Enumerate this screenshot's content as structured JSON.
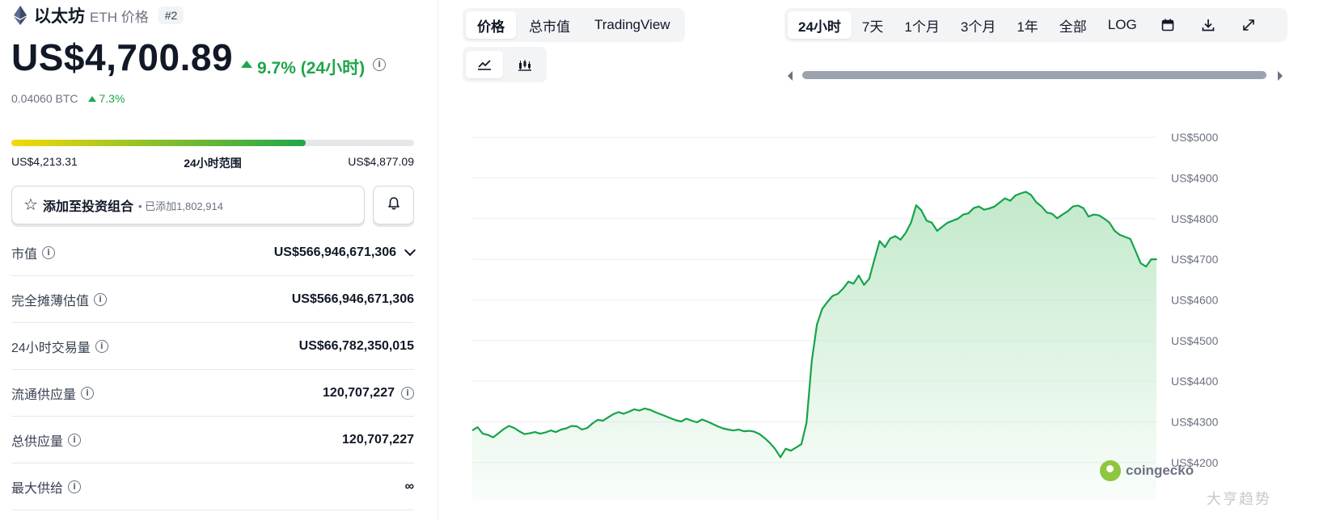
{
  "coin": {
    "name": "以太坊",
    "symbol_label": "ETH 价格",
    "rank": "#2",
    "icon": "ethereum-icon"
  },
  "price": {
    "value": "US$4,700.89",
    "change": "9.7% (24小时)",
    "btc_value": "0.04060 BTC",
    "btc_change": "7.3%"
  },
  "range": {
    "low": "US$4,213.31",
    "label": "24小时范围",
    "high": "US$4,877.09",
    "fill_fraction": 0.73
  },
  "portfolio": {
    "label": "添加至投资组合",
    "added": "已添加1,802,914"
  },
  "stats": [
    {
      "label": "市值",
      "value": "US$566,946,671,306",
      "info": true,
      "chevron": true,
      "value_info": false
    },
    {
      "label": "完全摊薄估值",
      "value": "US$566,946,671,306",
      "info": true,
      "chevron": false,
      "value_info": false
    },
    {
      "label": "24小时交易量",
      "value": "US$66,782,350,015",
      "info": true,
      "chevron": false,
      "value_info": false
    },
    {
      "label": "流通供应量",
      "value": "120,707,227",
      "info": true,
      "chevron": false,
      "value_info": true
    },
    {
      "label": "总供应量",
      "value": "120,707,227",
      "info": true,
      "chevron": false,
      "value_info": false
    },
    {
      "label": "最大供给",
      "value": "∞",
      "info": true,
      "chevron": false,
      "value_info": false
    }
  ],
  "chart_tabs": {
    "metric": [
      "价格",
      "总市值",
      "TradingView"
    ],
    "metric_active": 0,
    "chart_type": [
      "line-chart-icon",
      "candlestick-chart-icon"
    ],
    "range": [
      "24小时",
      "7天",
      "1个月",
      "3个月",
      "1年",
      "全部",
      "LOG"
    ],
    "range_active": 0,
    "range_icons": [
      "calendar-icon",
      "download-icon",
      "expand-icon"
    ]
  },
  "colors": {
    "up": "#1fa64a",
    "line": "#16a34a",
    "fill": "#bfe8c8"
  },
  "watermarks": {
    "coingecko": "coingecko",
    "overlay": "大亨趋势"
  },
  "chart_data": {
    "type": "area",
    "title": "",
    "xlabel": "",
    "ylabel": "",
    "ylim": [
      4150,
      5020
    ],
    "y_ticks": [
      4200,
      4300,
      4400,
      4500,
      4600,
      4700,
      4800,
      4900,
      5000
    ],
    "y_tick_labels": [
      "US$4200",
      "US$4300",
      "US$4400",
      "US$4500",
      "US$4600",
      "US$4700",
      "US$4800",
      "US$4900",
      "US$5000"
    ],
    "grid": true,
    "series": [
      {
        "values": [
          4279,
          4287,
          4271,
          4268,
          4262,
          4272,
          4282,
          4290,
          4285,
          4277,
          4270,
          4272,
          4275,
          4271,
          4274,
          4279,
          4275,
          4281,
          4284,
          4290,
          4289,
          4281,
          4285,
          4296,
          4305,
          4303,
          4311,
          4319,
          4324,
          4320,
          4325,
          4331,
          4328,
          4333,
          4330,
          4324,
          4319,
          4314,
          4309,
          4304,
          4301,
          4308,
          4303,
          4299,
          4306,
          4301,
          4295,
          4289,
          4284,
          4281,
          4279,
          4281,
          4277,
          4278,
          4276,
          4270,
          4260,
          4248,
          4233,
          4213,
          4234,
          4229,
          4237,
          4245,
          4298,
          4450,
          4540,
          4578,
          4595,
          4610,
          4615,
          4628,
          4645,
          4640,
          4660,
          4637,
          4652,
          4700,
          4745,
          4730,
          4751,
          4757,
          4748,
          4765,
          4790,
          4833,
          4820,
          4795,
          4790,
          4770,
          4780,
          4790,
          4795,
          4800,
          4810,
          4813,
          4826,
          4830,
          4822,
          4825,
          4830,
          4840,
          4850,
          4844,
          4857,
          4862,
          4866,
          4858,
          4840,
          4830,
          4815,
          4812,
          4801,
          4810,
          4818,
          4830,
          4832,
          4826,
          4805,
          4810,
          4808,
          4800,
          4790,
          4770,
          4760,
          4755,
          4750,
          4720,
          4690,
          4682,
          4700,
          4700
        ]
      }
    ]
  }
}
